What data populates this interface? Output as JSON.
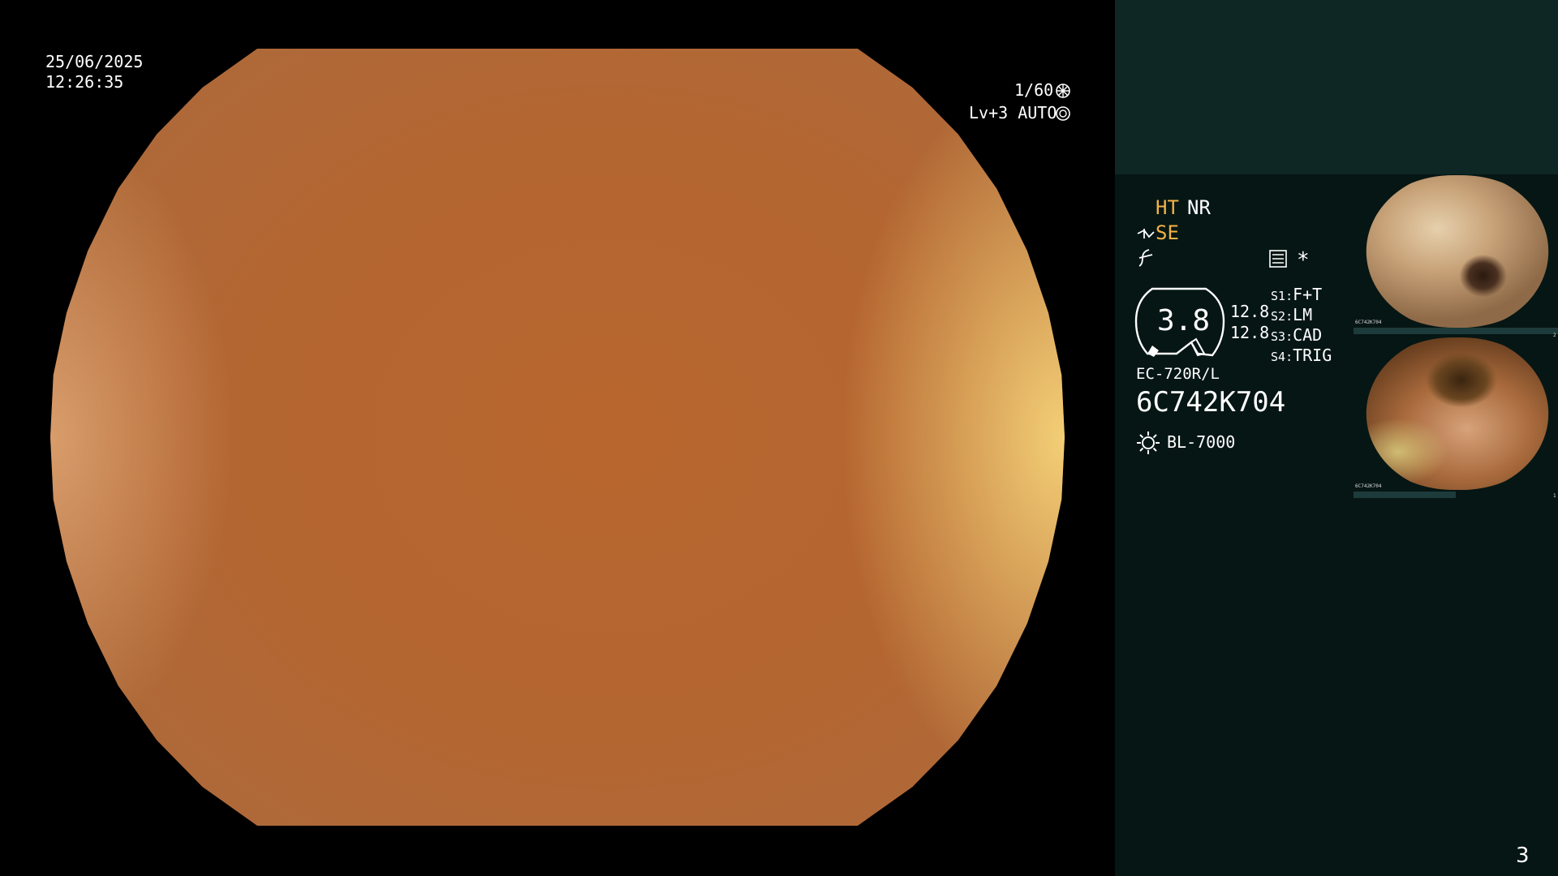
{
  "osd": {
    "date": "25/06/2025",
    "time": "12:26:35",
    "shutter": "1/60",
    "iris": "Lv+3 AUTO"
  },
  "panel": {
    "ht": "HT",
    "nr": "NR",
    "se": "SE",
    "pressure": "3.8",
    "value_upper": "12.8",
    "value_lower": "12.8",
    "switches": [
      {
        "key": "S1",
        "value": "F+T"
      },
      {
        "key": "S2",
        "value": "LM"
      },
      {
        "key": "S3",
        "value": "CAD"
      },
      {
        "key": "S4",
        "value": "TRIG"
      }
    ],
    "scope_model": "EC-720R/L",
    "scope_serial": "6C742K704",
    "light_source": "BL-7000",
    "page_number": "3"
  },
  "thumbnails": [
    {
      "serial": "6C742K704",
      "index": "2"
    },
    {
      "serial": "6C742K704",
      "index": "1"
    }
  ],
  "colors": {
    "orange_accent": "#f1b245",
    "panel_bg": "#061614",
    "panel_top_bg": "#0e2624",
    "view_tone": "#b46631"
  }
}
